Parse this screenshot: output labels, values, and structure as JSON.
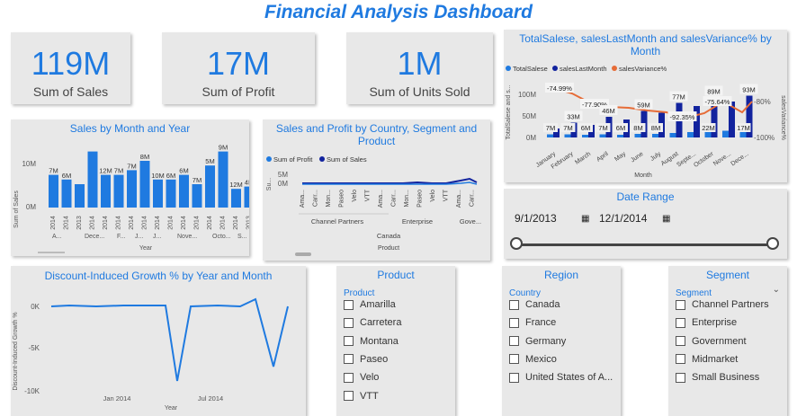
{
  "dashboard_title": "Financial Analysis Dashboard",
  "colors": {
    "accent": "#1f7ae0",
    "dark_blue": "#12239e",
    "orange": "#e66c37",
    "card_bg": "#e8e8e8"
  },
  "kpis": [
    {
      "value": "119M",
      "label": "Sum of  Sales"
    },
    {
      "value": "17M",
      "label": "Sum of Profit"
    },
    {
      "value": "1M",
      "label": "Sum of Units Sold"
    }
  ],
  "sales_by_month": {
    "title": "Sales by Month and Year",
    "ylabel": "Sum of Sales",
    "xlabel": "Year",
    "yticks": [
      "10M",
      "0M"
    ],
    "bar_labels": [
      "7M",
      "6M",
      "",
      "",
      "12M",
      "7M",
      "7M",
      "8M",
      "10M",
      "6M",
      "6M",
      "7M",
      "5M",
      "9M",
      "12M",
      "4M"
    ],
    "year_labels": [
      "2014",
      "2014",
      "2013",
      "2014",
      "2014",
      "2014",
      "2014",
      "2014",
      "2014",
      "2014",
      "2014",
      "2014",
      "2014",
      "2014",
      "2014",
      "2013"
    ],
    "month_labels": [
      "A...",
      "Dece...",
      "F...",
      "J...",
      "J...",
      "Nove...",
      "Octo...",
      "S..."
    ]
  },
  "sales_profit_country": {
    "title": "Sales and Profit by Country, Segment and Product",
    "legend": [
      "Sum of Profit",
      "Sum of  Sales"
    ],
    "yaxis_label": "Su...",
    "yticks": [
      "5M",
      "0M"
    ],
    "products": [
      "Ama...",
      "Carr...",
      "Mon...",
      "Paseo",
      "Velo",
      "VTT",
      "Ama...",
      "Carr...",
      "Mon...",
      "Paseo",
      "Velo",
      "VTT",
      "Ama...",
      "Carr..."
    ],
    "segments": [
      "Channel Partners",
      "Enterprise",
      "Gove..."
    ],
    "country": "Canada",
    "xlabel": "Product"
  },
  "combo_chart": {
    "title": "TotalSalese, salesLastMonth and salesVariance% by Month",
    "legend": [
      "TotalSalese",
      "salesLastMonth",
      "salesVariance%"
    ],
    "ylabel_left": "TotalSalese and s...",
    "ylabel_right": "salesVariance%",
    "yticks_left": [
      "100M",
      "50M",
      "0M"
    ],
    "yticks_right": [
      "-80%",
      "-100%"
    ],
    "xlabel": "Month",
    "months": [
      "January",
      "February",
      "March",
      "April",
      "May",
      "June",
      "July",
      "August",
      "Septe...",
      "October",
      "Nove...",
      "Dece..."
    ],
    "value_labels": [
      "7M",
      "7M",
      "6M",
      "7M",
      "6M",
      "8M",
      "8M",
      "",
      "",
      "22M",
      "",
      "17M"
    ],
    "top_labels": [
      "",
      "33M",
      "",
      "46M",
      "",
      "59M",
      "",
      "77M",
      "",
      "89M",
      "",
      "93M"
    ],
    "variance_labels": [
      "-74.99%",
      "",
      "-77.90%",
      "",
      "",
      "",
      "",
      "-92.35%",
      "",
      "-75.64%",
      "",
      ""
    ]
  },
  "date_range": {
    "title": "Date Range",
    "start": "9/1/2013",
    "end": "12/1/2014"
  },
  "discount_growth": {
    "title": "Discount-Induced Growth % by Year and Month",
    "ylabel": "Discount-Induced Growth %",
    "yticks": [
      "0K",
      "-5K",
      "-10K"
    ],
    "xticks": [
      "Jan 2014",
      "Jul 2014"
    ],
    "xlabel": "Year"
  },
  "product_slicer": {
    "title": "Product",
    "header": "Product",
    "items": [
      "Amarilla",
      "Carretera",
      "Montana",
      "Paseo",
      "Velo",
      "VTT"
    ]
  },
  "region_slicer": {
    "title": "Region",
    "header": "Country",
    "items": [
      "Canada",
      "France",
      "Germany",
      "Mexico",
      "United States of A..."
    ]
  },
  "segment_slicer": {
    "title": "Segment",
    "header": "Segment",
    "items": [
      "Channel Partners",
      "Enterprise",
      "Government",
      "Midmarket",
      "Small Business"
    ]
  }
}
